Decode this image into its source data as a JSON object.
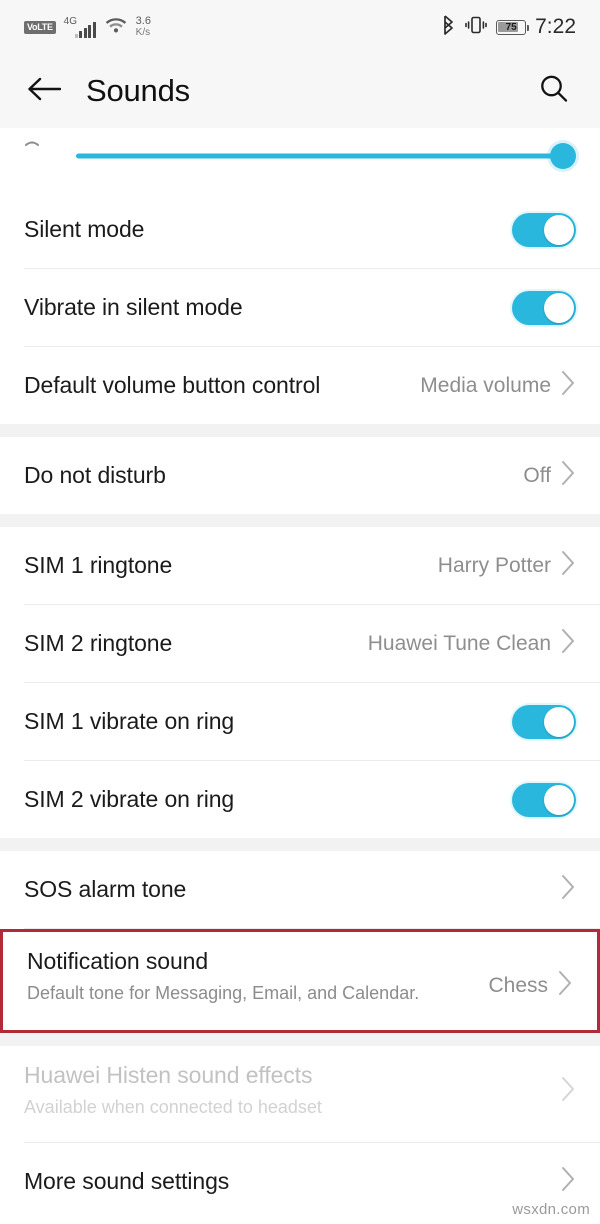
{
  "status_bar": {
    "volte": "VoLTE",
    "network_generation": "4G",
    "net_speed_value": "3.6",
    "net_speed_unit": "K/s",
    "bluetooth_icon": "bluetooth-icon",
    "vibrate_icon": "vibrate-icon",
    "battery_percent": "75",
    "time": "7:22"
  },
  "appbar": {
    "back_icon": "back-arrow-icon",
    "title": "Sounds",
    "search_icon": "search-icon"
  },
  "volume_slider": {
    "icon": "volume-icon",
    "value": 100,
    "fill_color": "#2ab7dd"
  },
  "sections": [
    {
      "rows": [
        {
          "label": "Silent mode",
          "control": "toggle",
          "toggle_on": true
        },
        {
          "label": "Vibrate in silent mode",
          "control": "toggle",
          "toggle_on": true
        },
        {
          "label": "Default volume button control",
          "control": "value",
          "value": "Media volume"
        }
      ]
    },
    {
      "rows": [
        {
          "label": "Do not disturb",
          "control": "value",
          "value": "Off"
        }
      ]
    },
    {
      "rows": [
        {
          "label": "SIM 1 ringtone",
          "control": "value",
          "value": "Harry Potter"
        },
        {
          "label": "SIM 2 ringtone",
          "control": "value",
          "value": "Huawei Tune Clean"
        },
        {
          "label": "SIM 1 vibrate on ring",
          "control": "toggle",
          "toggle_on": true
        },
        {
          "label": "SIM 2 vibrate on ring",
          "control": "toggle",
          "toggle_on": true
        }
      ]
    },
    {
      "rows": [
        {
          "label": "SOS alarm tone",
          "control": "chevron",
          "value": ""
        },
        {
          "label": "Notification sound",
          "sub": "Default tone for Messaging, Email, and Calendar.",
          "control": "value",
          "value": "Chess",
          "highlighted": true
        }
      ]
    },
    {
      "rows": [
        {
          "label": "Huawei Histen sound effects",
          "sub": "Available when connected to headset",
          "control": "chevron",
          "value": "",
          "disabled": true
        },
        {
          "label": "More sound settings",
          "control": "chevron",
          "value": ""
        }
      ]
    }
  ],
  "highlight_color": "#b22a38",
  "accent_color": "#2ab7dd",
  "watermark": "wsxdn.com"
}
